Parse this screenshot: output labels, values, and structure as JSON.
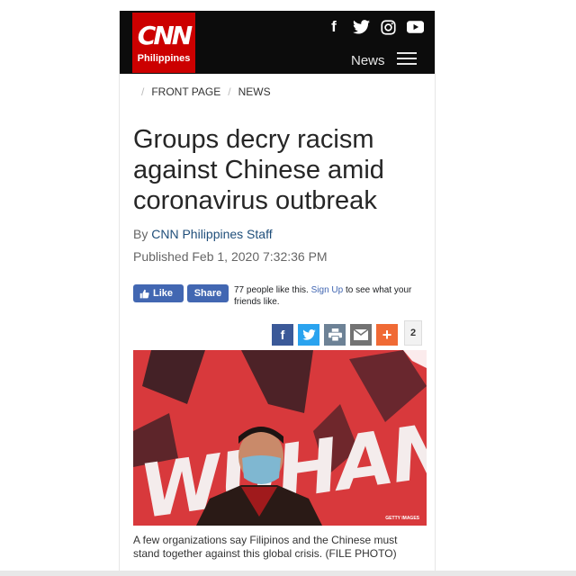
{
  "header": {
    "logo_text": "CNN",
    "logo_sub": "Philippines",
    "nav_label": "News",
    "social_icons": [
      "facebook-icon",
      "twitter-icon",
      "instagram-icon",
      "youtube-icon"
    ],
    "accent": "#cc0000"
  },
  "breadcrumb": [
    "FRONT PAGE",
    "NEWS"
  ],
  "article": {
    "title": "Groups decry racism against Chinese amid coronavirus outbreak",
    "by_prefix": "By",
    "author": "CNN Philippines Staff",
    "published": "Published Feb 1, 2020 7:32:36 PM"
  },
  "facebook": {
    "like_label": "Like",
    "share_label": "Share",
    "likes_text": "77 people like this.",
    "signup_label": "Sign Up",
    "signup_suffix": "to see what your friends like."
  },
  "share_bar": {
    "icons": [
      "facebook-share-icon",
      "twitter-share-icon",
      "print-icon",
      "email-icon",
      "plus-icon"
    ],
    "count": "2"
  },
  "photo": {
    "banner_text": "WUHAN",
    "credit": "GETTY IMAGES",
    "caption": "A few organizations say Filipinos and the Chinese must stand together against this global crisis. (FILE PHOTO)"
  }
}
